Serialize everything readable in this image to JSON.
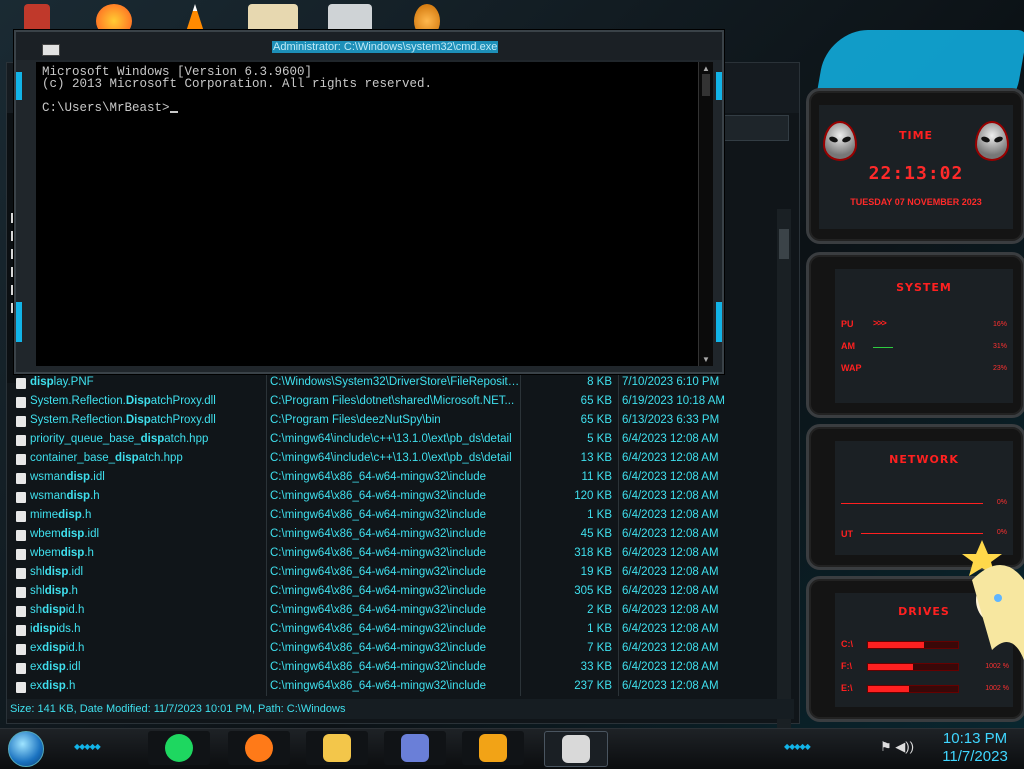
{
  "cmd": {
    "title": "Administrator: C:\\Windows\\system32\\cmd.exe",
    "lines": [
      "Microsoft Windows [Version 6.3.9600]",
      "(c) 2013 Microsoft Corporation. All rights reserved.",
      "",
      "C:\\Users\\MrBeast>"
    ]
  },
  "explorer": {
    "status": "Size: 141 KB, Date Modified: 11/7/2023 10:01 PM, Path: C:\\Windows",
    "files": [
      {
        "pre": "",
        "bold": "disp",
        "post": "lay.PNF",
        "path": "C:\\Windows\\System32\\DriverStore\\FileReposito...",
        "size": "8 KB",
        "date": "7/10/2023 6:10 PM"
      },
      {
        "pre": "System.Reflection.",
        "bold": "Disp",
        "post": "atchProxy.dll",
        "path": "C:\\Program Files\\dotnet\\shared\\Microsoft.NET...",
        "size": "65 KB",
        "date": "6/19/2023 10:18 AM"
      },
      {
        "pre": "System.Reflection.",
        "bold": "Disp",
        "post": "atchProxy.dll",
        "path": "C:\\Program Files\\deezNutSpy\\bin",
        "size": "65 KB",
        "date": "6/13/2023 6:33 PM"
      },
      {
        "pre": "priority_queue_base_",
        "bold": "disp",
        "post": "atch.hpp",
        "path": "C:\\mingw64\\include\\c++\\13.1.0\\ext\\pb_ds\\detail",
        "size": "5 KB",
        "date": "6/4/2023 12:08 AM"
      },
      {
        "pre": "container_base_",
        "bold": "disp",
        "post": "atch.hpp",
        "path": "C:\\mingw64\\include\\c++\\13.1.0\\ext\\pb_ds\\detail",
        "size": "13 KB",
        "date": "6/4/2023 12:08 AM"
      },
      {
        "pre": "wsman",
        "bold": "disp",
        "post": ".idl",
        "path": "C:\\mingw64\\x86_64-w64-mingw32\\include",
        "size": "11 KB",
        "date": "6/4/2023 12:08 AM"
      },
      {
        "pre": "wsman",
        "bold": "disp",
        "post": ".h",
        "path": "C:\\mingw64\\x86_64-w64-mingw32\\include",
        "size": "120 KB",
        "date": "6/4/2023 12:08 AM"
      },
      {
        "pre": "mime",
        "bold": "disp",
        "post": ".h",
        "path": "C:\\mingw64\\x86_64-w64-mingw32\\include",
        "size": "1 KB",
        "date": "6/4/2023 12:08 AM"
      },
      {
        "pre": "wbem",
        "bold": "disp",
        "post": ".idl",
        "path": "C:\\mingw64\\x86_64-w64-mingw32\\include",
        "size": "45 KB",
        "date": "6/4/2023 12:08 AM"
      },
      {
        "pre": "wbem",
        "bold": "disp",
        "post": ".h",
        "path": "C:\\mingw64\\x86_64-w64-mingw32\\include",
        "size": "318 KB",
        "date": "6/4/2023 12:08 AM"
      },
      {
        "pre": "shl",
        "bold": "disp",
        "post": ".idl",
        "path": "C:\\mingw64\\x86_64-w64-mingw32\\include",
        "size": "19 KB",
        "date": "6/4/2023 12:08 AM"
      },
      {
        "pre": "shl",
        "bold": "disp",
        "post": ".h",
        "path": "C:\\mingw64\\x86_64-w64-mingw32\\include",
        "size": "305 KB",
        "date": "6/4/2023 12:08 AM"
      },
      {
        "pre": "sh",
        "bold": "disp",
        "post": "id.h",
        "path": "C:\\mingw64\\x86_64-w64-mingw32\\include",
        "size": "2 KB",
        "date": "6/4/2023 12:08 AM"
      },
      {
        "pre": "i",
        "bold": "disp",
        "post": "ids.h",
        "path": "C:\\mingw64\\x86_64-w64-mingw32\\include",
        "size": "1 KB",
        "date": "6/4/2023 12:08 AM"
      },
      {
        "pre": "ex",
        "bold": "disp",
        "post": "id.h",
        "path": "C:\\mingw64\\x86_64-w64-mingw32\\include",
        "size": "7 KB",
        "date": "6/4/2023 12:08 AM"
      },
      {
        "pre": "ex",
        "bold": "disp",
        "post": ".idl",
        "path": "C:\\mingw64\\x86_64-w64-mingw32\\include",
        "size": "33 KB",
        "date": "6/4/2023 12:08 AM"
      },
      {
        "pre": "ex",
        "bold": "disp",
        "post": ".h",
        "path": "C:\\mingw64\\x86_64-w64-mingw32\\include",
        "size": "237 KB",
        "date": "6/4/2023 12:08 AM"
      }
    ]
  },
  "gadgets": {
    "time": {
      "title": "TIME",
      "clock": "22:13:02",
      "date": "TUESDAY 07 NOVEMBER 2023"
    },
    "system": {
      "title": "SYSTEM",
      "rows": [
        {
          "label": "PU",
          "value": "16%",
          "usage": 0.16
        },
        {
          "label": "AM",
          "value": "31%",
          "usage": 0.31
        },
        {
          "label": "WAP",
          "value": "23%",
          "usage": 0.23
        }
      ]
    },
    "network": {
      "title": "NETWORK",
      "rows": [
        {
          "label": "",
          "value": "0%"
        },
        {
          "label": "UT",
          "value": "0%"
        }
      ]
    },
    "drives": {
      "title": "DRIVES",
      "rows": [
        {
          "label": "C:\\",
          "value": "",
          "usage": 0.62
        },
        {
          "label": "F:\\",
          "value": "1002 %",
          "usage": 0.5
        },
        {
          "label": "E:\\",
          "value": "1002 %",
          "usage": 0.45
        }
      ]
    }
  },
  "taskbar": {
    "clock_time": "10:13 PM",
    "clock_date": "11/7/2023",
    "apps": [
      {
        "name": "spotify-icon",
        "color": "#1ed760"
      },
      {
        "name": "firefox-icon",
        "color": "#ff7a18"
      },
      {
        "name": "file-explorer-icon",
        "color": "#f3c64a"
      },
      {
        "name": "control-panel-icon",
        "color": "#6a7fd8"
      },
      {
        "name": "search-icon",
        "color": "#f2a316"
      },
      {
        "name": "cmd-icon",
        "color": "#d9d9d9"
      }
    ]
  },
  "colors": {
    "accent": "#12b4e8",
    "text_cyan": "#3fe0ee",
    "gadget_red": "#ff2020"
  }
}
